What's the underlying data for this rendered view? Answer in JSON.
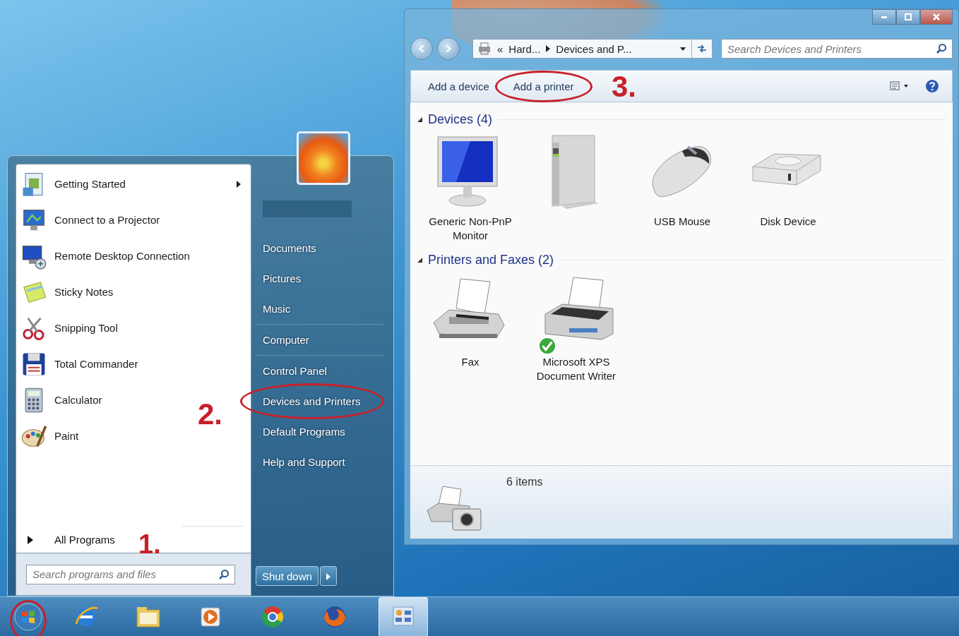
{
  "start_menu": {
    "programs": [
      {
        "label": "Getting Started",
        "has_submenu": true
      },
      {
        "label": "Connect to a Projector",
        "has_submenu": false
      },
      {
        "label": "Remote Desktop Connection",
        "has_submenu": false
      },
      {
        "label": "Sticky Notes",
        "has_submenu": false
      },
      {
        "label": "Snipping Tool",
        "has_submenu": false
      },
      {
        "label": "Total Commander",
        "has_submenu": false
      },
      {
        "label": "Calculator",
        "has_submenu": false
      },
      {
        "label": "Paint",
        "has_submenu": false
      }
    ],
    "all_programs": "All Programs",
    "search": {
      "placeholder": "Search programs and files"
    },
    "places": [
      {
        "label": "Documents",
        "circled": false
      },
      {
        "label": "Pictures",
        "circled": false
      },
      {
        "label": "Music",
        "circled": false
      },
      {
        "label": "Computer",
        "circled": false
      },
      {
        "label": "Control Panel",
        "circled": false
      },
      {
        "label": "Devices and Printers",
        "circled": true
      },
      {
        "label": "Default Programs",
        "circled": false
      },
      {
        "label": "Help and Support",
        "circled": false
      }
    ],
    "shutdown": {
      "label": "Shut down"
    }
  },
  "annotations": [
    {
      "label": "1."
    },
    {
      "label": "2."
    },
    {
      "label": "3."
    }
  ],
  "explorer": {
    "address": {
      "overflow": "«",
      "segments": [
        "Hard...",
        "Devices and P..."
      ]
    },
    "search": {
      "placeholder": "Search Devices and Printers"
    },
    "toolbar": [
      {
        "label": "Add a device",
        "circled": false
      },
      {
        "label": "Add a printer",
        "circled": true
      }
    ],
    "groups": [
      {
        "title": "Devices (4)",
        "expanded": true,
        "items": [
          {
            "label": "Generic Non-PnP Monitor",
            "default": false
          },
          {
            "default": false
          },
          {
            "label": "USB Mouse",
            "default": false
          },
          {
            "label": "Disk Device",
            "default": false
          }
        ]
      },
      {
        "title": "Printers and Faxes (2)",
        "expanded": true,
        "items": [
          {
            "label": "Fax",
            "default": false
          },
          {
            "label": "Microsoft XPS Document Writer",
            "default": true
          }
        ]
      }
    ],
    "status": "6 items"
  },
  "taskbar": {
    "start": {
      "circled": true
    },
    "items": [
      {
        "active": false
      },
      {
        "active": false
      },
      {
        "active": false
      },
      {
        "active": false
      },
      {
        "active": false
      },
      {
        "active": true
      }
    ]
  }
}
